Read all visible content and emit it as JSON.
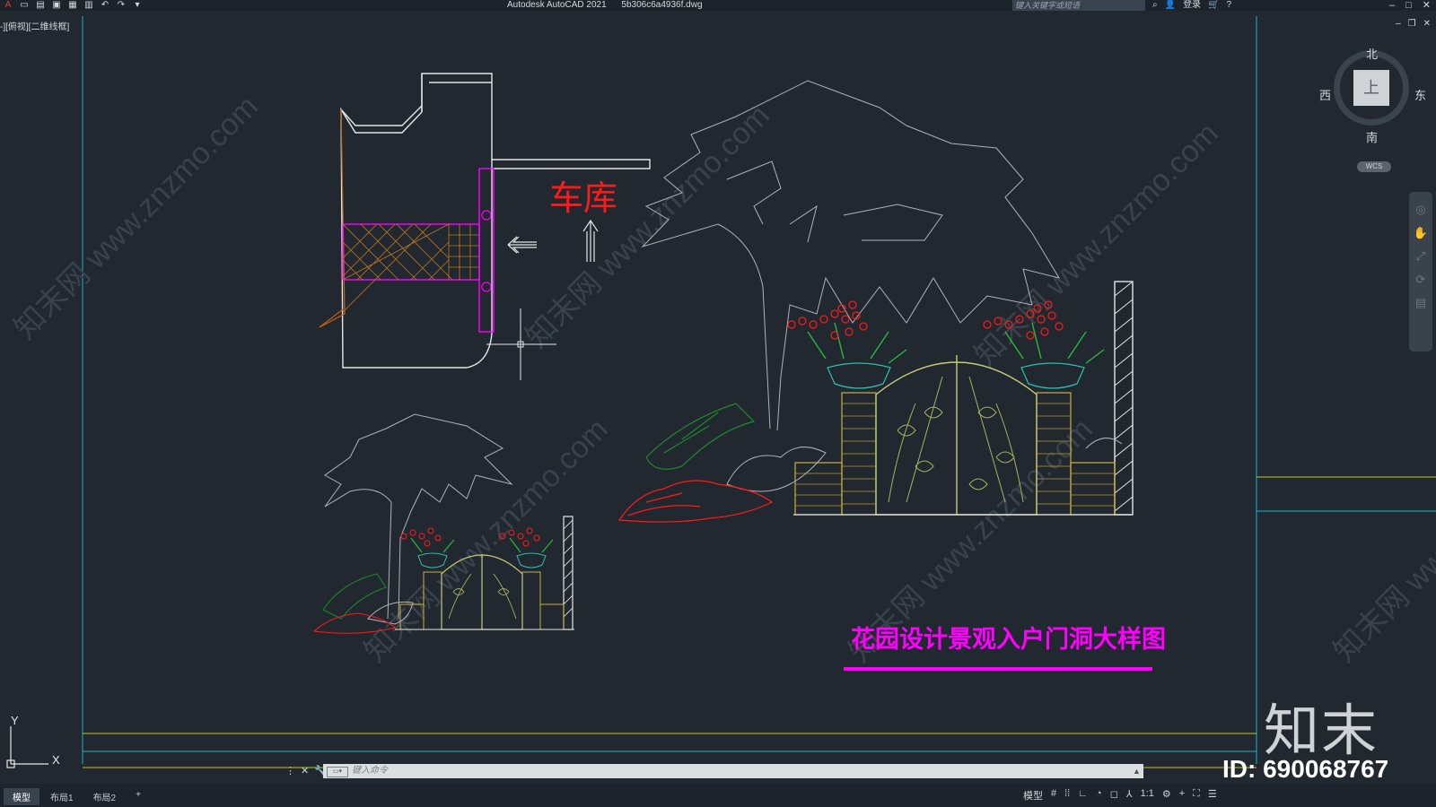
{
  "app": {
    "name": "Autodesk AutoCAD 2021",
    "file": "5b306c6a4936f.dwg",
    "search_placeholder": "键入关键字或短语",
    "login": "登录",
    "view_label": "-][俯视][二维线框]"
  },
  "viewcube": {
    "north": "北",
    "south": "南",
    "west": "西",
    "east": "东",
    "face": "上",
    "wcs": "WCS"
  },
  "drawing": {
    "garage_label": "车库",
    "title": "花园设计景观入户门洞大样图",
    "ucs_x": "X",
    "ucs_y": "Y",
    "watermark": "知末网 www.znzmo.com"
  },
  "command": {
    "placeholder": "键入命令"
  },
  "status": {
    "tabs": [
      "模型",
      "布局1",
      "布局2",
      "+"
    ],
    "model": "模型",
    "scale": "1:1"
  },
  "overlay": {
    "logo": "知末",
    "id": "ID: 690068767"
  },
  "colors": {
    "background": "#212830",
    "cyan": "#18b4c8",
    "yellow": "#c8c818",
    "magenta": "#ff00ff",
    "red": "#ff1a1a"
  }
}
